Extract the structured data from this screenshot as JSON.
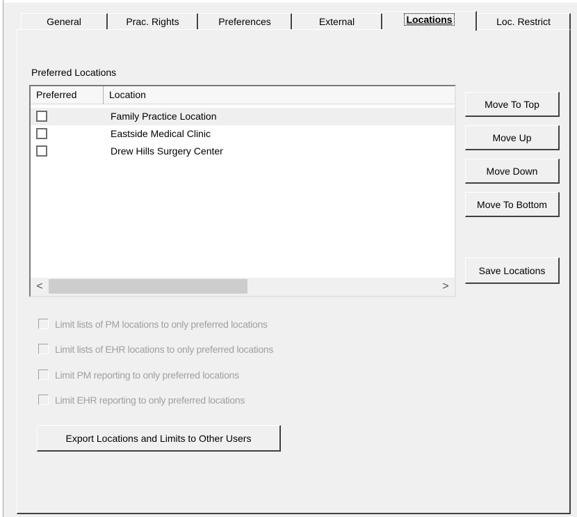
{
  "tabs": [
    {
      "label": "General"
    },
    {
      "label": "Prac. Rights"
    },
    {
      "label": "Preferences"
    },
    {
      "label": "External"
    },
    {
      "label": "Locations"
    },
    {
      "label": "Loc. Restrict"
    }
  ],
  "active_tab": "Locations",
  "section_title": "Preferred Locations",
  "list": {
    "columns": [
      "Preferred",
      "Location"
    ],
    "rows": [
      {
        "preferred": false,
        "location": "Family Practice Location"
      },
      {
        "preferred": false,
        "location": "Eastside Medical Clinic"
      },
      {
        "preferred": false,
        "location": "Drew Hills Surgery Center"
      }
    ]
  },
  "buttons": {
    "move_top": "Move To Top",
    "move_up": "Move Up",
    "move_down": "Move Down",
    "move_bottom": "Move To Bottom",
    "save": "Save Locations",
    "export": "Export Locations and Limits to Other Users"
  },
  "limits": [
    {
      "label": "Limit lists of PM locations to only preferred locations",
      "checked": false,
      "enabled": false
    },
    {
      "label": "Limit lists of EHR locations to only preferred locations",
      "checked": false,
      "enabled": false
    },
    {
      "label": "Limit PM reporting to only preferred locations",
      "checked": false,
      "enabled": false
    },
    {
      "label": "Limit EHR reporting to only preferred locations",
      "checked": false,
      "enabled": false
    }
  ],
  "scroll_arrows": {
    "left": "<",
    "right": ">"
  }
}
